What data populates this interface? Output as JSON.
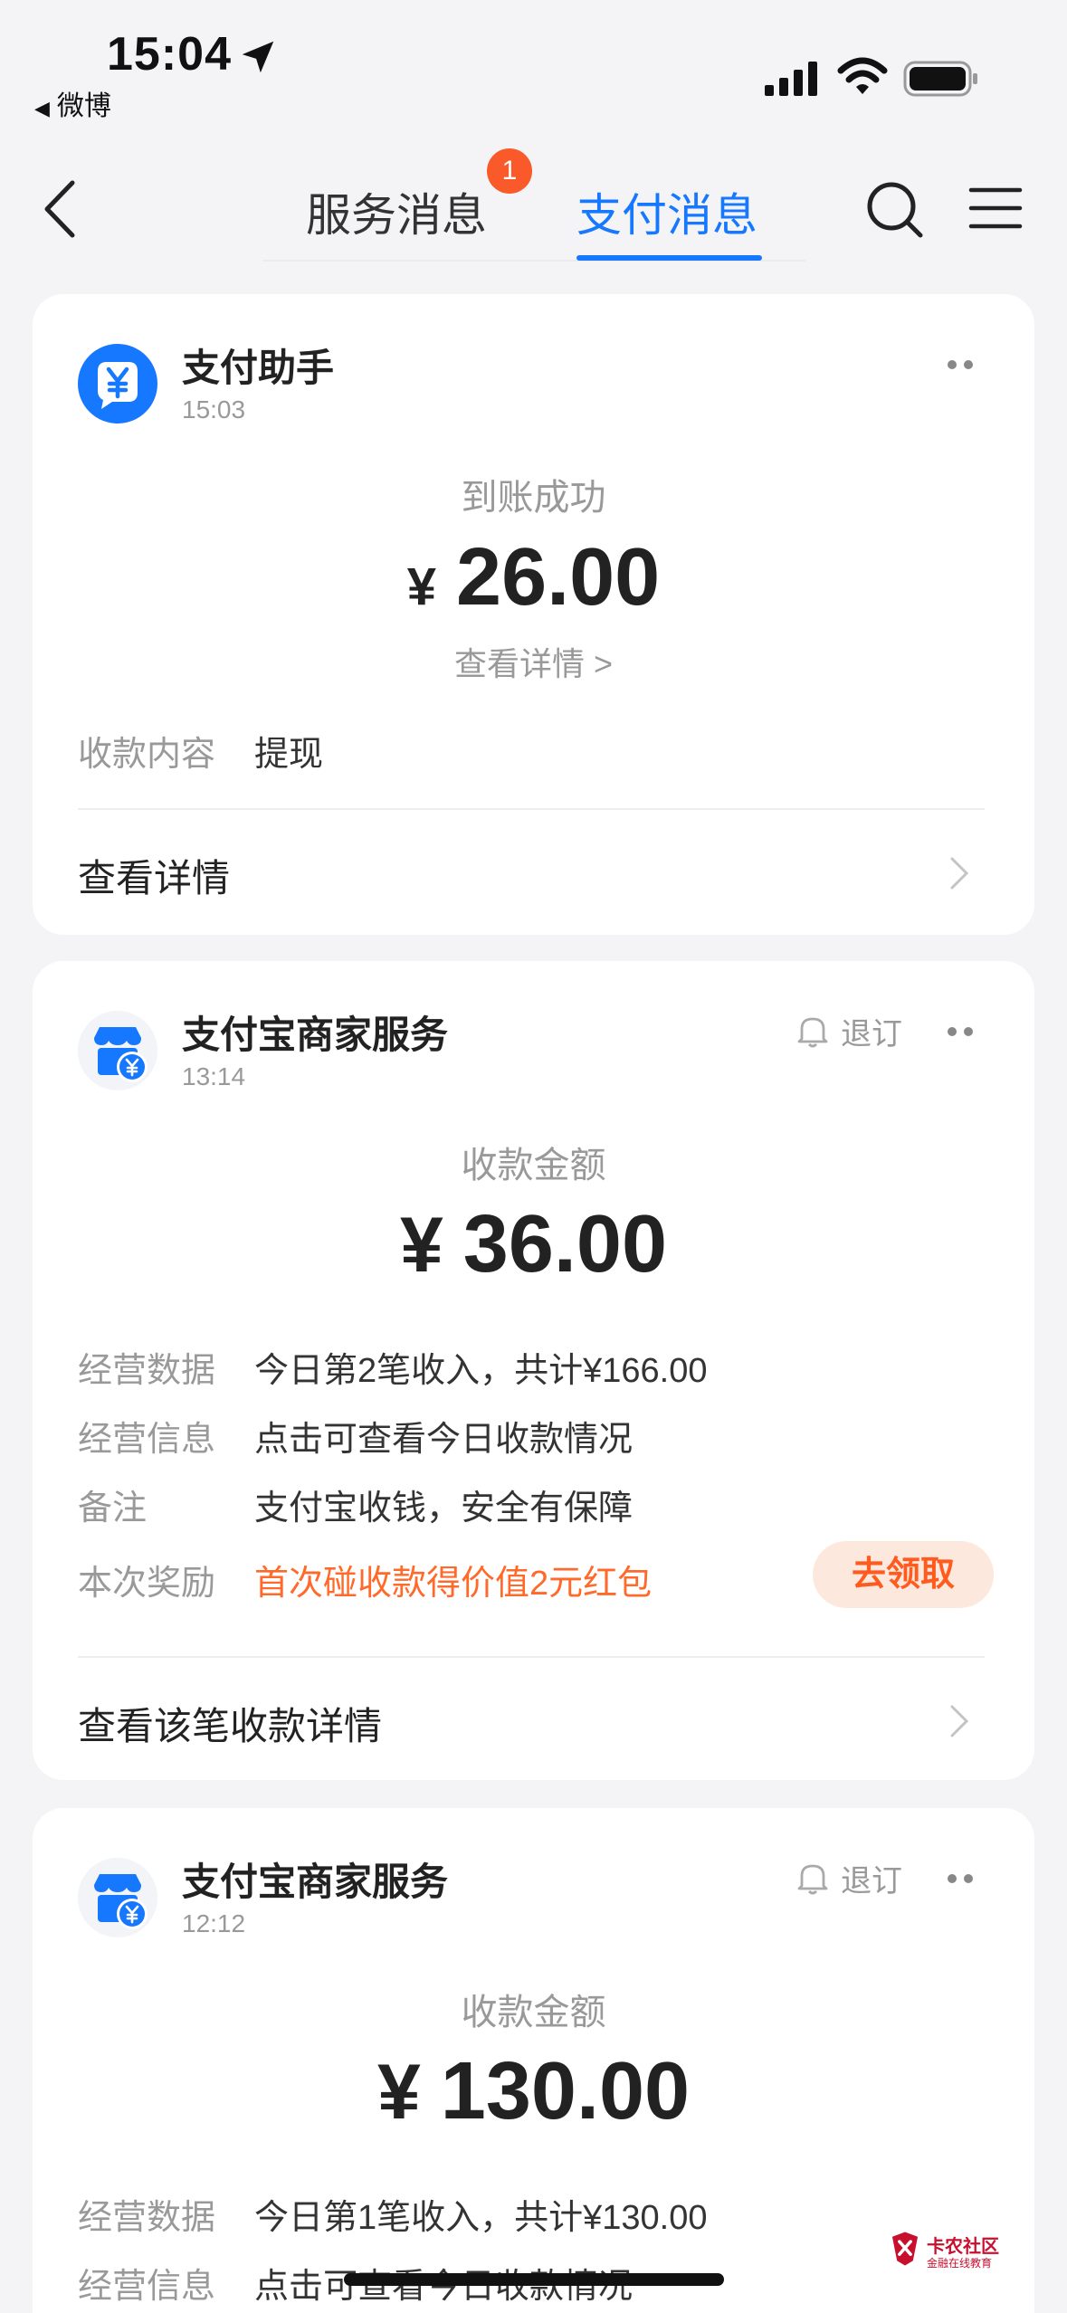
{
  "status_bar": {
    "time": "15:04",
    "back_app": "微博"
  },
  "nav": {
    "tabs": [
      {
        "label": "服务消息",
        "badge": "1"
      },
      {
        "label": "支付消息",
        "active": true
      }
    ]
  },
  "messages": [
    {
      "sender": "支付助手",
      "time": "15:03",
      "title": "到账成功",
      "currency": "¥",
      "amount": "26.00",
      "detail_link": "查看详情 >",
      "rows": [
        {
          "label": "收款内容",
          "value": "提现"
        }
      ],
      "footer": "查看详情"
    },
    {
      "sender": "支付宝商家服务",
      "time": "13:14",
      "unsubscribe": "退订",
      "title": "收款金额",
      "currency": "¥",
      "amount": "36.00",
      "rows": [
        {
          "label": "经营数据",
          "value": "今日第2笔收入，共计¥166.00"
        },
        {
          "label": "经营信息",
          "value": "点击可查看今日收款情况"
        },
        {
          "label": "备注",
          "value": "支付宝收钱，安全有保障"
        },
        {
          "label": "本次奖励",
          "value": "首次碰收款得价值2元红包"
        }
      ],
      "claim_button": "去领取",
      "footer": "查看该笔收款详情"
    },
    {
      "sender": "支付宝商家服务",
      "time": "12:12",
      "unsubscribe": "退订",
      "title": "收款金额",
      "currency": "¥",
      "amount": "130.00",
      "rows": [
        {
          "label": "经营数据",
          "value": "今日第1笔收入，共计¥130.00"
        },
        {
          "label": "经营信息",
          "value": "点击可查看今日收款情况"
        }
      ]
    }
  ],
  "watermark": {
    "title": "卡农社区",
    "subtitle": "金融在线教育"
  },
  "colors": {
    "accent": "#1677ff",
    "badge": "#fa5a2a",
    "reward": "#ff6a2b",
    "claim_bg": "#fde8de"
  }
}
